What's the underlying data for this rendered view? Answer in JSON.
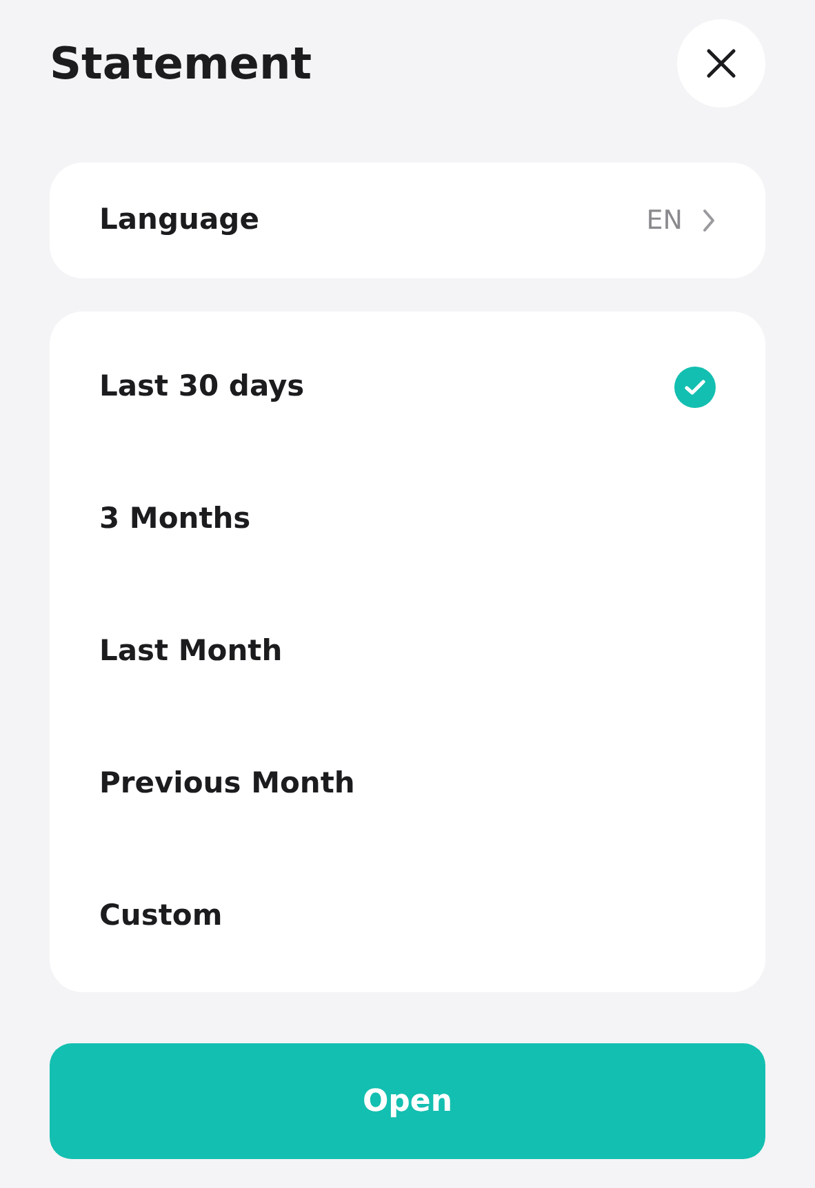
{
  "header": {
    "title": "Statement"
  },
  "language": {
    "label": "Language",
    "value": "EN"
  },
  "periods": [
    {
      "label": "Last 30 days",
      "selected": true
    },
    {
      "label": "3 Months",
      "selected": false
    },
    {
      "label": "Last Month",
      "selected": false
    },
    {
      "label": "Previous Month",
      "selected": false
    },
    {
      "label": "Custom",
      "selected": false
    }
  ],
  "buttons": [
    "Open"
  ]
}
